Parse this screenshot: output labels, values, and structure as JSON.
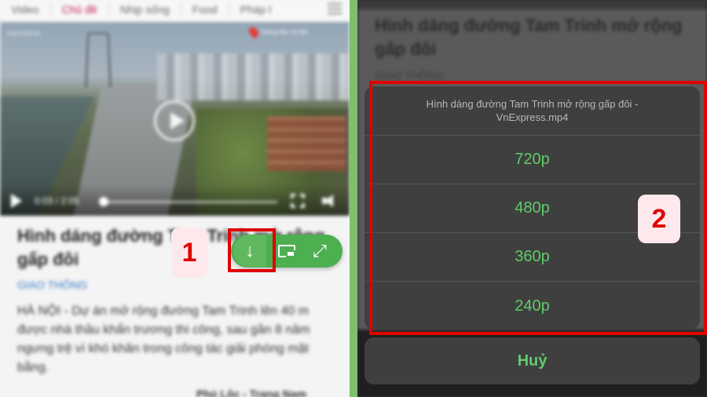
{
  "left": {
    "tabs": [
      "Video",
      "Chủ đề",
      "Nhịp sống",
      "Food",
      "Pháp l"
    ],
    "video": {
      "logo_text": "VNEXPRESS",
      "location": "Hoàng Mai, Hà Nội",
      "time": "0:03 / 2:05"
    },
    "article": {
      "title": "Hình dáng đường Tam Trinh mở rộng gấp đôi",
      "category": "GIAO THÔNG",
      "excerpt": "HÀ NỘI - Dự án mở rộng đường Tam Trinh lên 40 m được nhà thầu khẩn trương thi công, sau gần 8 năm ngưng trệ vì khó khăn trong công tác giải phóng mặt bằng.",
      "byline": "Phú Lộc - Trang Nam"
    },
    "toolbar": {
      "download_icon": "↓",
      "expand_icon": "⤢"
    },
    "step_label": "1"
  },
  "right": {
    "background_title": "Hình dáng đường Tam Trinh mở rộng gấp đôi",
    "background_category": "GIAO THÔNG",
    "sheet": {
      "title": "Hình dáng đường Tam Trinh mở rộng gấp đôi - VnExpress.mp4",
      "options": [
        "720p",
        "480p",
        "360p",
        "240p"
      ],
      "cancel_label": "Huỷ"
    },
    "step_label": "2"
  },
  "colors": {
    "accent_green": "#4caf50",
    "option_text": "#5fcc6a",
    "highlight_red": "#e00000",
    "category_blue": "#3a79c3"
  }
}
